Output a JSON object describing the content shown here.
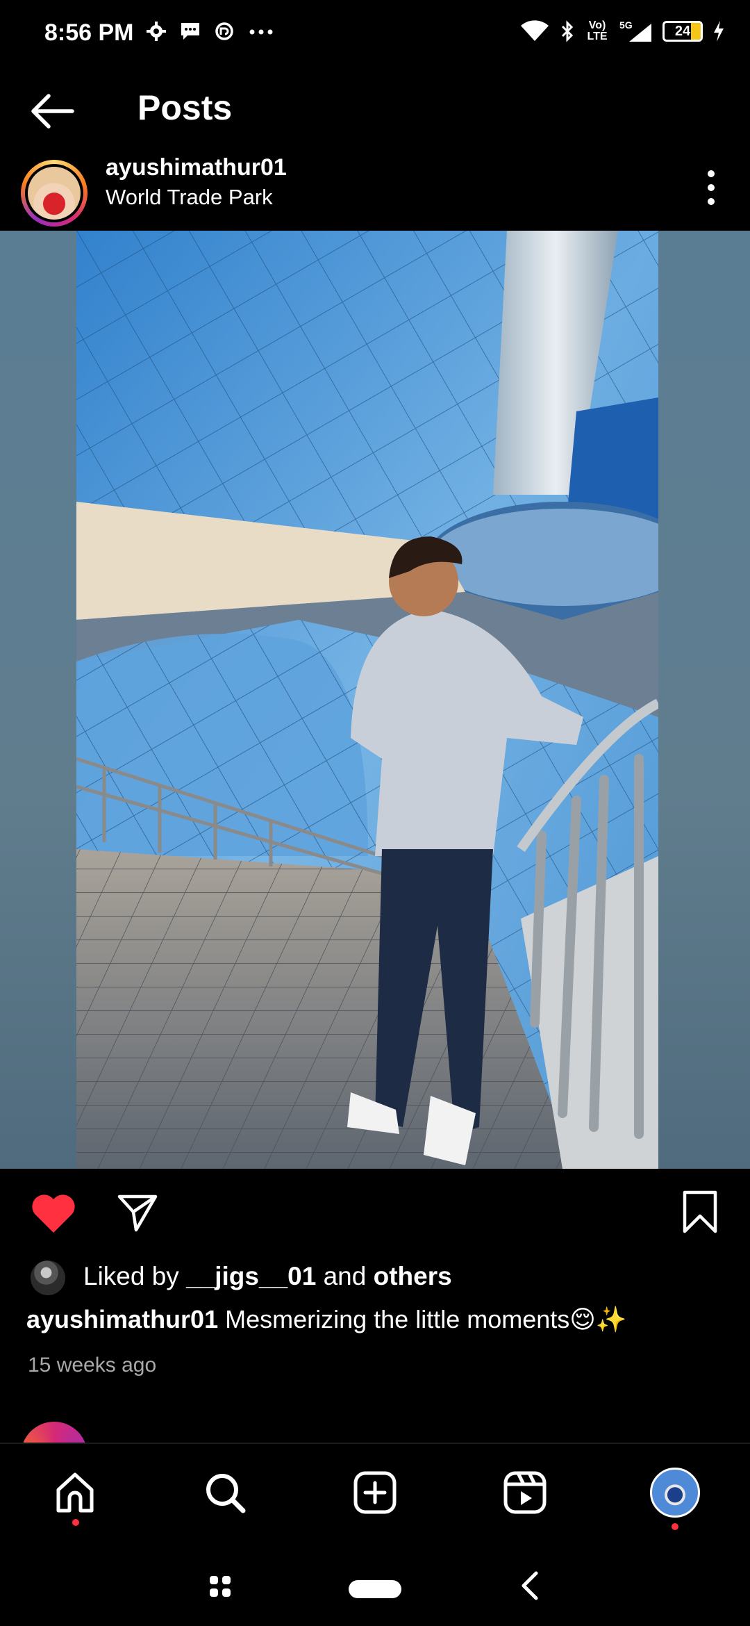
{
  "status_bar": {
    "time": "8:56 PM",
    "left_icons": [
      "gear-icon",
      "message-icon",
      "app-icon",
      "more-dots-icon"
    ],
    "right_icons": [
      "wifi-icon",
      "bluetooth-icon",
      "volte-icon",
      "signal-icon",
      "battery-icon",
      "charging-icon"
    ],
    "volte_label_top": "Vo)",
    "volte_label_bottom": "LTE",
    "network_label": "5G",
    "battery_level": "24"
  },
  "header": {
    "title": "Posts",
    "back_icon": "arrow-left-icon"
  },
  "post": {
    "username": "ayushimathur01",
    "location": "World Trade Park",
    "more_icon": "vertical-dots-icon",
    "liked_by_prefix": "Liked by ",
    "liked_by_user": "__jigs__01",
    "liked_by_middle": " and ",
    "liked_by_others": "others",
    "caption_user": "ayushimathur01",
    "caption_text": " Mesmerizing the little moments😌✨",
    "timestamp": "15 weeks ago"
  },
  "bottom_nav": {
    "items": [
      "home-icon",
      "search-icon",
      "create-icon",
      "reels-icon",
      "profile-avatar"
    ]
  },
  "colors": {
    "like": "#ff3040",
    "background": "#000000",
    "muted_text": "#a8a8a8"
  }
}
